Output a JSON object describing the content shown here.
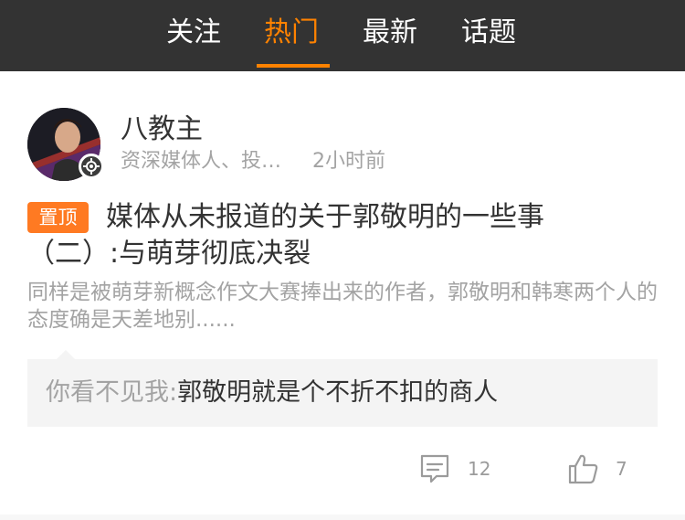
{
  "tabs": [
    {
      "label": "关注",
      "active": false
    },
    {
      "label": "热门",
      "active": true
    },
    {
      "label": "最新",
      "active": false
    },
    {
      "label": "话题",
      "active": false
    }
  ],
  "colors": {
    "accent": "#ff8200",
    "pin": "#ff7a22",
    "topbar": "#333333"
  },
  "post": {
    "author": "八教主",
    "author_desc": "资深媒体人、投…",
    "time": "2小时前",
    "pin_label": "置顶",
    "title": "媒体从未报道的关于郭敬明的一些事（二）:与萌芽彻底决裂",
    "summary": "同样是被萌芽新概念作文大赛捧出来的作者，郭敬明和韩寒两个人的态度确是天差地别......",
    "comment": {
      "name": "你看不见我:",
      "text": "郭敬明就是个不折不扣的商人"
    },
    "comment_count": "12",
    "like_count": "7"
  },
  "icons": {
    "comment": "comment-icon",
    "like": "thumbs-up-icon",
    "verified": "verified-badge-icon"
  }
}
